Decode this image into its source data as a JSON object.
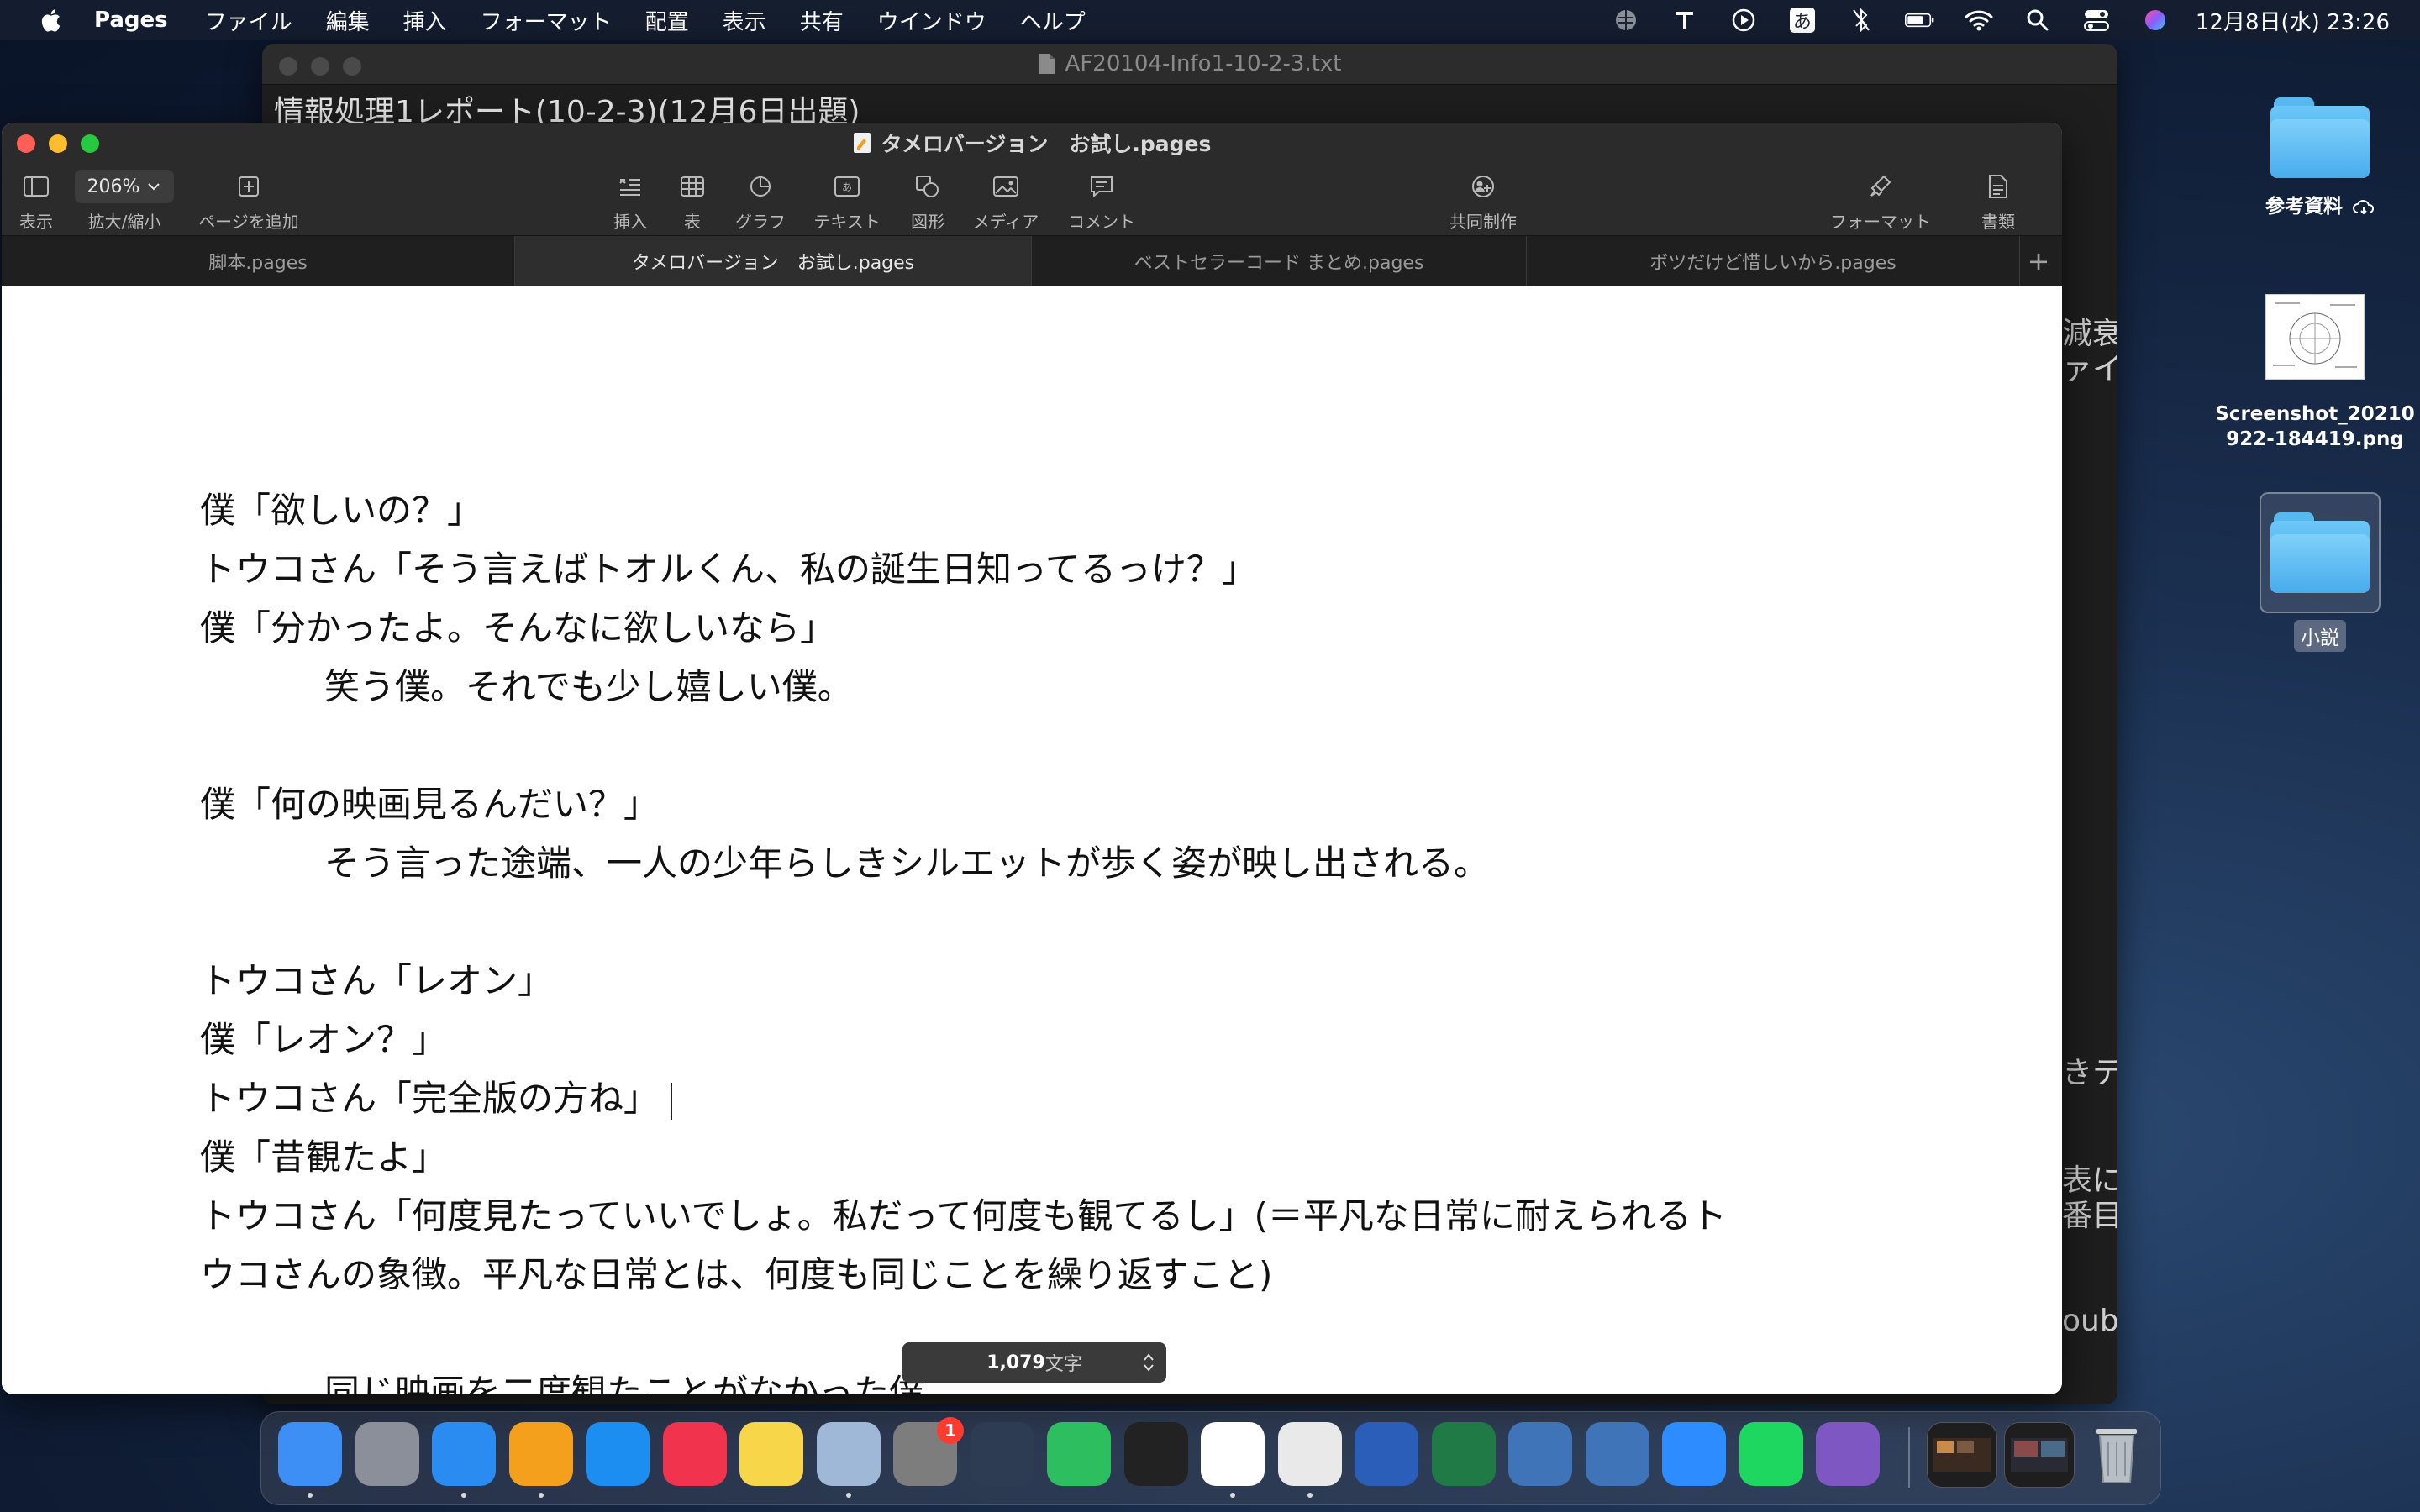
{
  "menubar": {
    "app_name": "Pages",
    "items": [
      "ファイル",
      "編集",
      "挿入",
      "フォーマット",
      "配置",
      "表示",
      "共有",
      "ウインドウ",
      "ヘルプ"
    ],
    "input_mode": "あ",
    "clock": "12月8日(水)  23:26"
  },
  "back_window": {
    "title": "AF20104-Info1-10-2-3.txt",
    "content": "情報処理1レポート(10-2-3)(12月6日出題)",
    "peek_lines": [
      "減衰",
      "ァイノ",
      "きテ",
      "表につ",
      "番目",
      "oub"
    ]
  },
  "desktop": {
    "icons": [
      {
        "label": "参考資料"
      },
      {
        "label": "Screenshot_20210922-184419.png",
        "label_line1": "Screenshot_20210",
        "label_line2": "922-184419.png"
      },
      {
        "label": "小説"
      }
    ]
  },
  "pages": {
    "window_title": "タメロバージョン　お試し.pages",
    "toolbar": {
      "view": "表示",
      "zoom_value": "206%",
      "zoom": "拡大/縮小",
      "add_page": "ページを追加",
      "insert": "挿入",
      "table": "表",
      "chart": "グラフ",
      "text": "テキスト",
      "shape": "図形",
      "media": "メディア",
      "comment": "コメント",
      "collaborate": "共同制作",
      "format": "フォーマット",
      "document": "書類"
    },
    "tabs": [
      {
        "label": "脚本.pages",
        "active": false
      },
      {
        "label": "タメロバージョン　お試し.pages",
        "active": true
      },
      {
        "label": "ベストセラーコード まとめ.pages",
        "active": false
      },
      {
        "label": "ボツだけど惜しいから.pages",
        "active": false
      }
    ],
    "lines": [
      "僕「欲しいの？」",
      "トウコさん「そう言えばトオルくん、私の誕生日知ってるっけ？」",
      "僕「分かったよ。そんなに欲しいなら」",
      "笑う僕。それでも少し嬉しい僕。",
      "僕「何の映画見るんだい？」",
      "そう言った途端、一人の少年らしきシルエットが歩く姿が映し出される。",
      "トウコさん「レオン」",
      "僕「レオン？」",
      "トウコさん「完全版の方ね」",
      "僕「昔観たよ」",
      "トウコさん「何度見たっていいでしょ。私だって何度も観てるし」(＝平凡な日常に耐えられるト",
      "ウコさんの象徴。平凡な日常とは、何度も同じことを繰り返すこと)",
      "同じ映画を二度観たことがなかった僕。"
    ],
    "word_count_num": "1,079",
    "word_count_unit": "文字"
  },
  "dock": {
    "apps": [
      {
        "name": "Finder",
        "icon": "finder-icon",
        "color": "#3d8ef5"
      },
      {
        "name": "Launchpad",
        "icon": "launchpad-icon",
        "color": "#8a8f99"
      },
      {
        "name": "Safari",
        "icon": "safari-icon",
        "color": "#2a8cf0"
      },
      {
        "name": "Pages",
        "icon": "pages-icon",
        "color": "#f4a01c"
      },
      {
        "name": "App Store",
        "icon": "app-store-icon",
        "color": "#1c8ef2"
      },
      {
        "name": "Music",
        "icon": "music-icon",
        "color": "#f2334d"
      },
      {
        "name": "Notes",
        "icon": "notes-icon",
        "color": "#f7d64a"
      },
      {
        "name": "Preview",
        "icon": "preview-icon",
        "color": "#9fb8d8"
      },
      {
        "name": "System Preferences",
        "icon": "system-preferences-icon",
        "color": "#7d7d7d",
        "badge": "1"
      },
      {
        "name": "QuickTime",
        "icon": "quicktime-icon",
        "color": "#2d3c52"
      },
      {
        "name": "Evernote",
        "icon": "evernote-icon",
        "color": "#2dbe60"
      },
      {
        "name": "Voice Memos",
        "icon": "voice-memos-icon",
        "color": "#222222"
      },
      {
        "name": "Chrome",
        "icon": "chrome-icon",
        "color": "#ffffff"
      },
      {
        "name": "TextEdit",
        "icon": "textedit-icon",
        "color": "#e9e9e9"
      },
      {
        "name": "Word",
        "icon": "word-icon",
        "color": "#2b5eb8"
      },
      {
        "name": "Excel",
        "icon": "excel-icon",
        "color": "#1f7a45"
      },
      {
        "name": "VirtualBox",
        "icon": "virtualbox-icon",
        "color": "#3f74b8"
      },
      {
        "name": "VirtualBox VM",
        "icon": "virtualbox-vm-icon",
        "color": "#3f74b8"
      },
      {
        "name": "Zoom",
        "icon": "zoom-icon",
        "color": "#2d8cff"
      },
      {
        "name": "Spotify",
        "icon": "spotify-icon",
        "color": "#1ed760"
      },
      {
        "name": "Emacs",
        "icon": "emacs-icon",
        "color": "#7e57c2"
      }
    ],
    "colors": {
      "lights_red": "#ff5f57",
      "lights_yellow": "#febc2e",
      "lights_green": "#28c840"
    }
  }
}
